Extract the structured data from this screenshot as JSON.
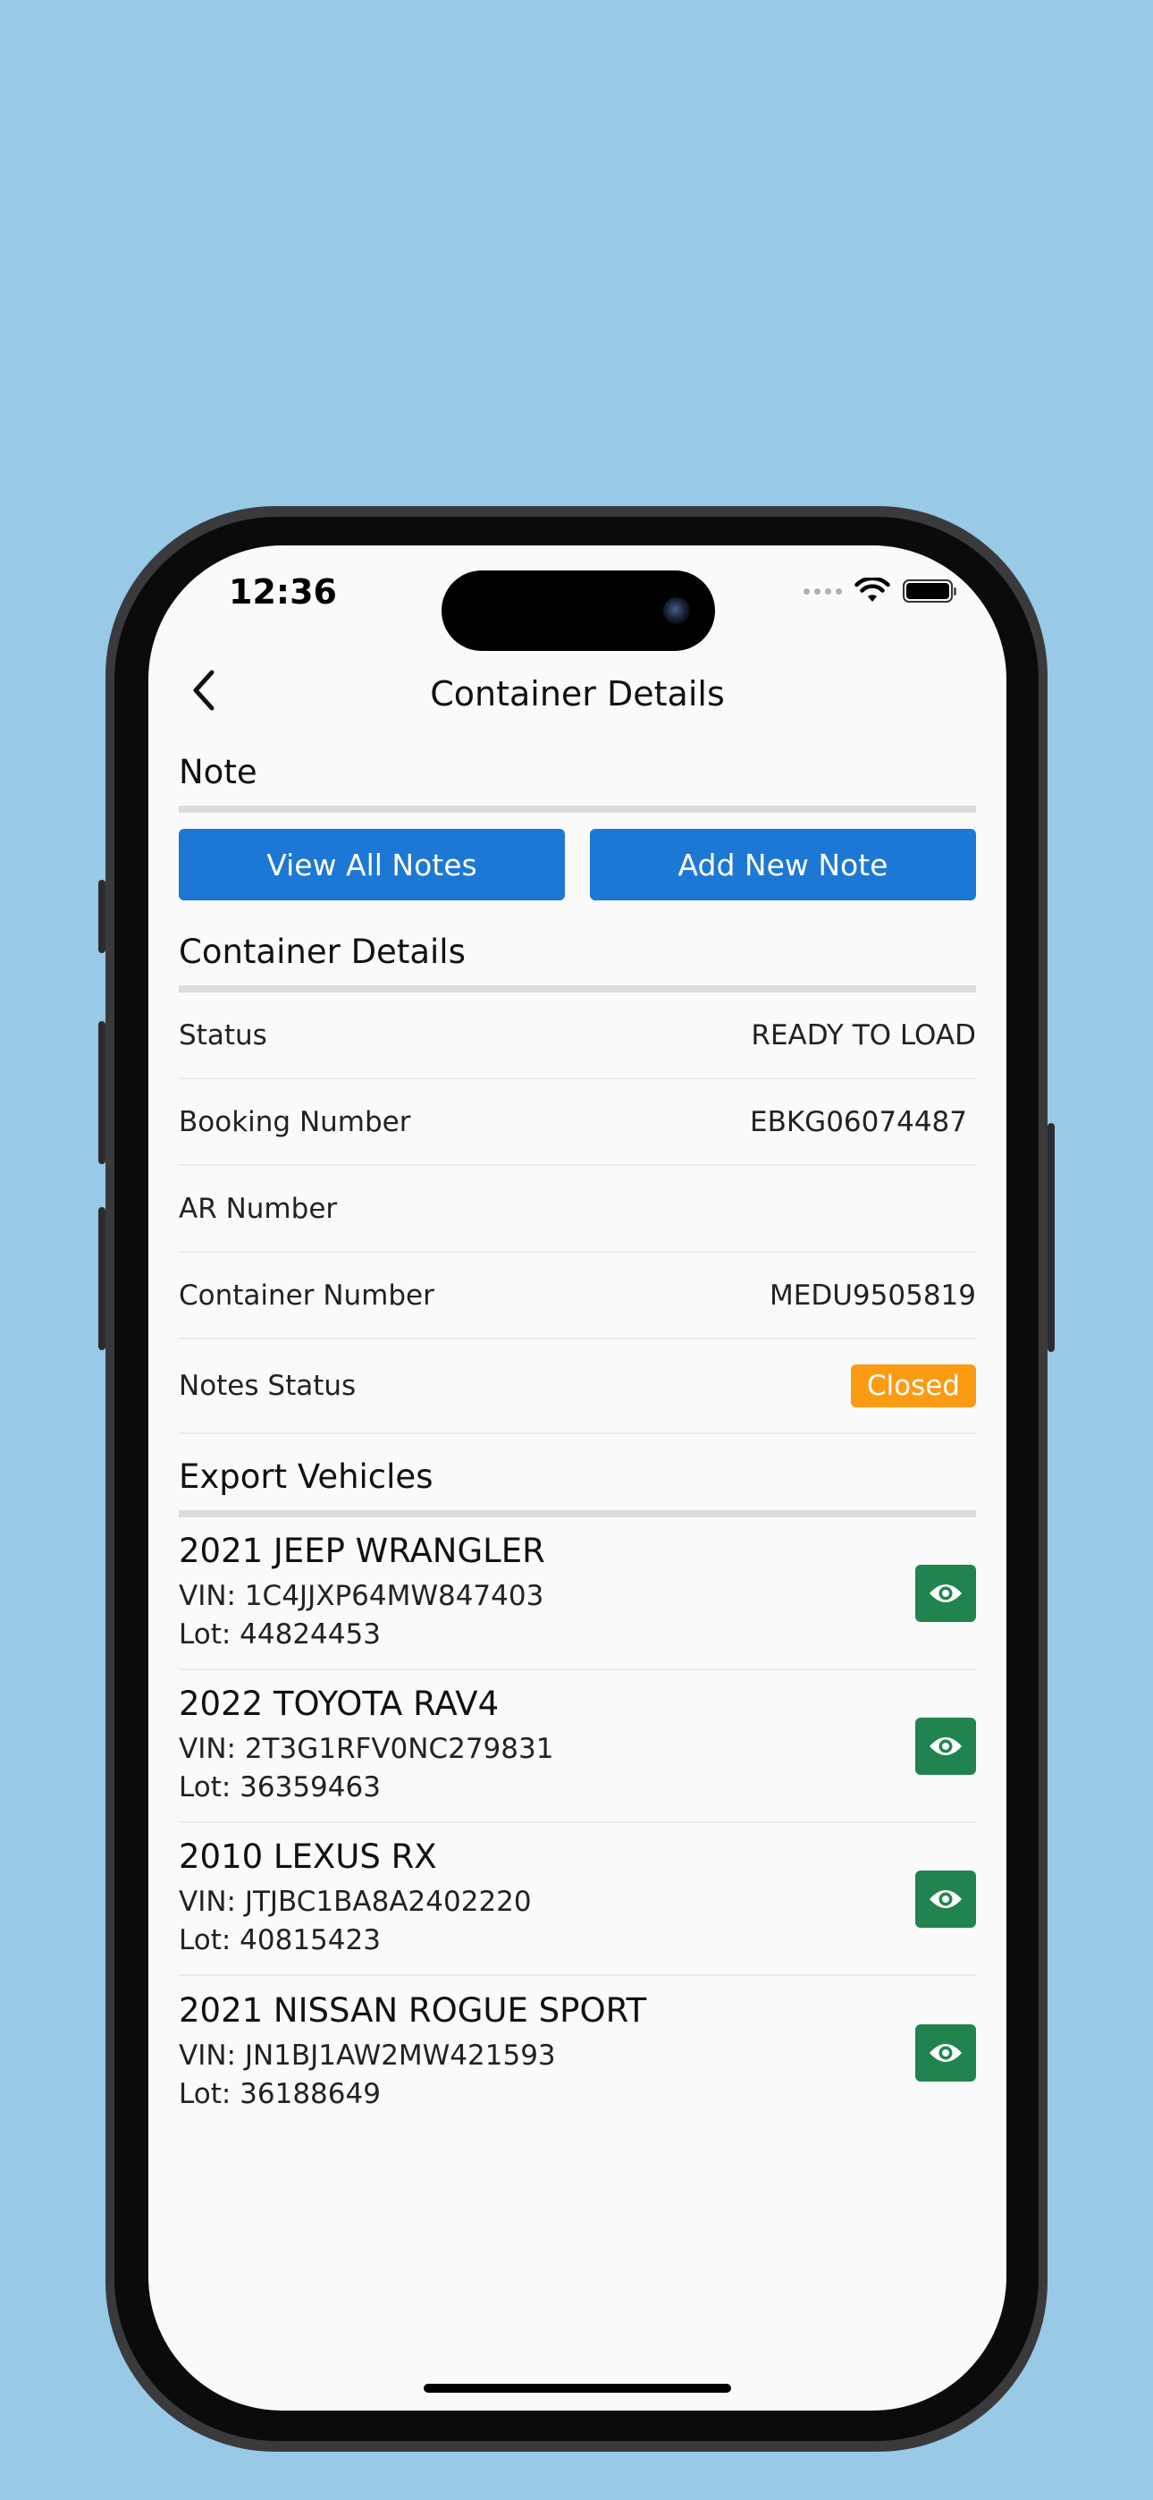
{
  "status_bar": {
    "time": "12:36"
  },
  "nav": {
    "title": "Container Details",
    "back_icon": "chevron-left-icon"
  },
  "note_section": {
    "title": "Note",
    "buttons": {
      "view_all": "View All Notes",
      "add_new": "Add New Note"
    }
  },
  "details_section": {
    "title": "Container Details",
    "rows": [
      {
        "label": "Status",
        "value": "READY TO LOAD"
      },
      {
        "label": "Booking Number",
        "value": "EBKG06074487"
      },
      {
        "label": "AR Number",
        "value": ""
      },
      {
        "label": "Container Number",
        "value": "MEDU9505819"
      }
    ],
    "notes_status": {
      "label": "Notes Status",
      "value": "Closed"
    }
  },
  "vehicles_section": {
    "title": "Export Vehicles",
    "items": [
      {
        "name": "2021 JEEP WRANGLER",
        "vin": "VIN: 1C4JJXP64MW847403",
        "lot": "Lot: 44824453"
      },
      {
        "name": "2022 TOYOTA RAV4",
        "vin": "VIN: 2T3G1RFV0NC279831",
        "lot": "Lot: 36359463"
      },
      {
        "name": "2010 LEXUS RX",
        "vin": "VIN: JTJBC1BA8A2402220",
        "lot": "Lot: 40815423"
      },
      {
        "name": "2021 NISSAN ROGUE SPORT",
        "vin": "VIN: JN1BJ1AW2MW421593",
        "lot": "Lot: 36188649"
      }
    ]
  },
  "colors": {
    "background": "#98c9e7",
    "primary_button": "#1d77d4",
    "badge_closed": "#fb9b12",
    "view_button": "#21844f"
  }
}
